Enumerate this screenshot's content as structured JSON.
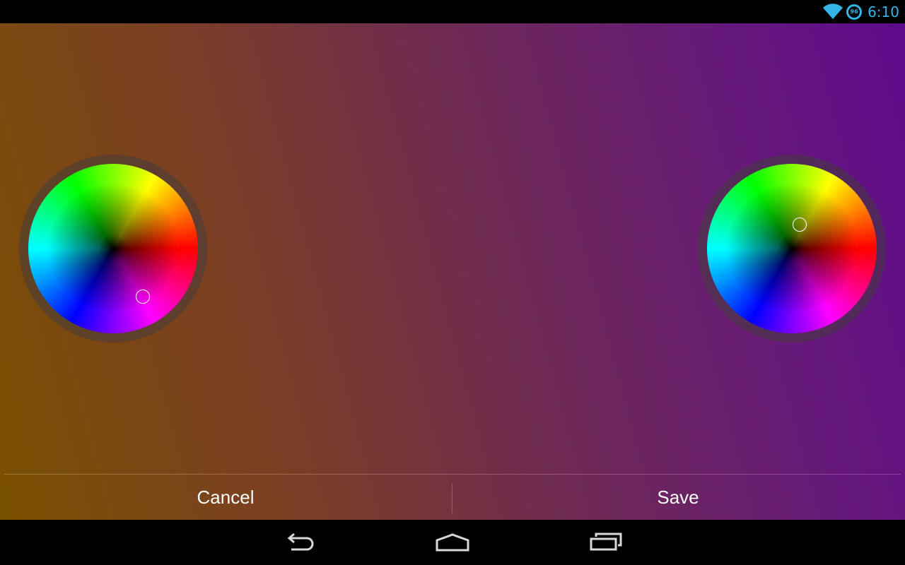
{
  "status_bar": {
    "icons": [
      "wifi-icon",
      "battery-icon"
    ],
    "battery_level": "96",
    "time": "6:10",
    "accent_color": "#33b5e5"
  },
  "color_pickers": {
    "left": {
      "icon": "color-wheel"
    },
    "right": {
      "icon": "color-wheel"
    }
  },
  "dialog_buttons": {
    "cancel_label": "Cancel",
    "save_label": "Save"
  },
  "navigation_bar": {
    "icons": [
      "back-icon",
      "home-icon",
      "recents-icon"
    ]
  }
}
